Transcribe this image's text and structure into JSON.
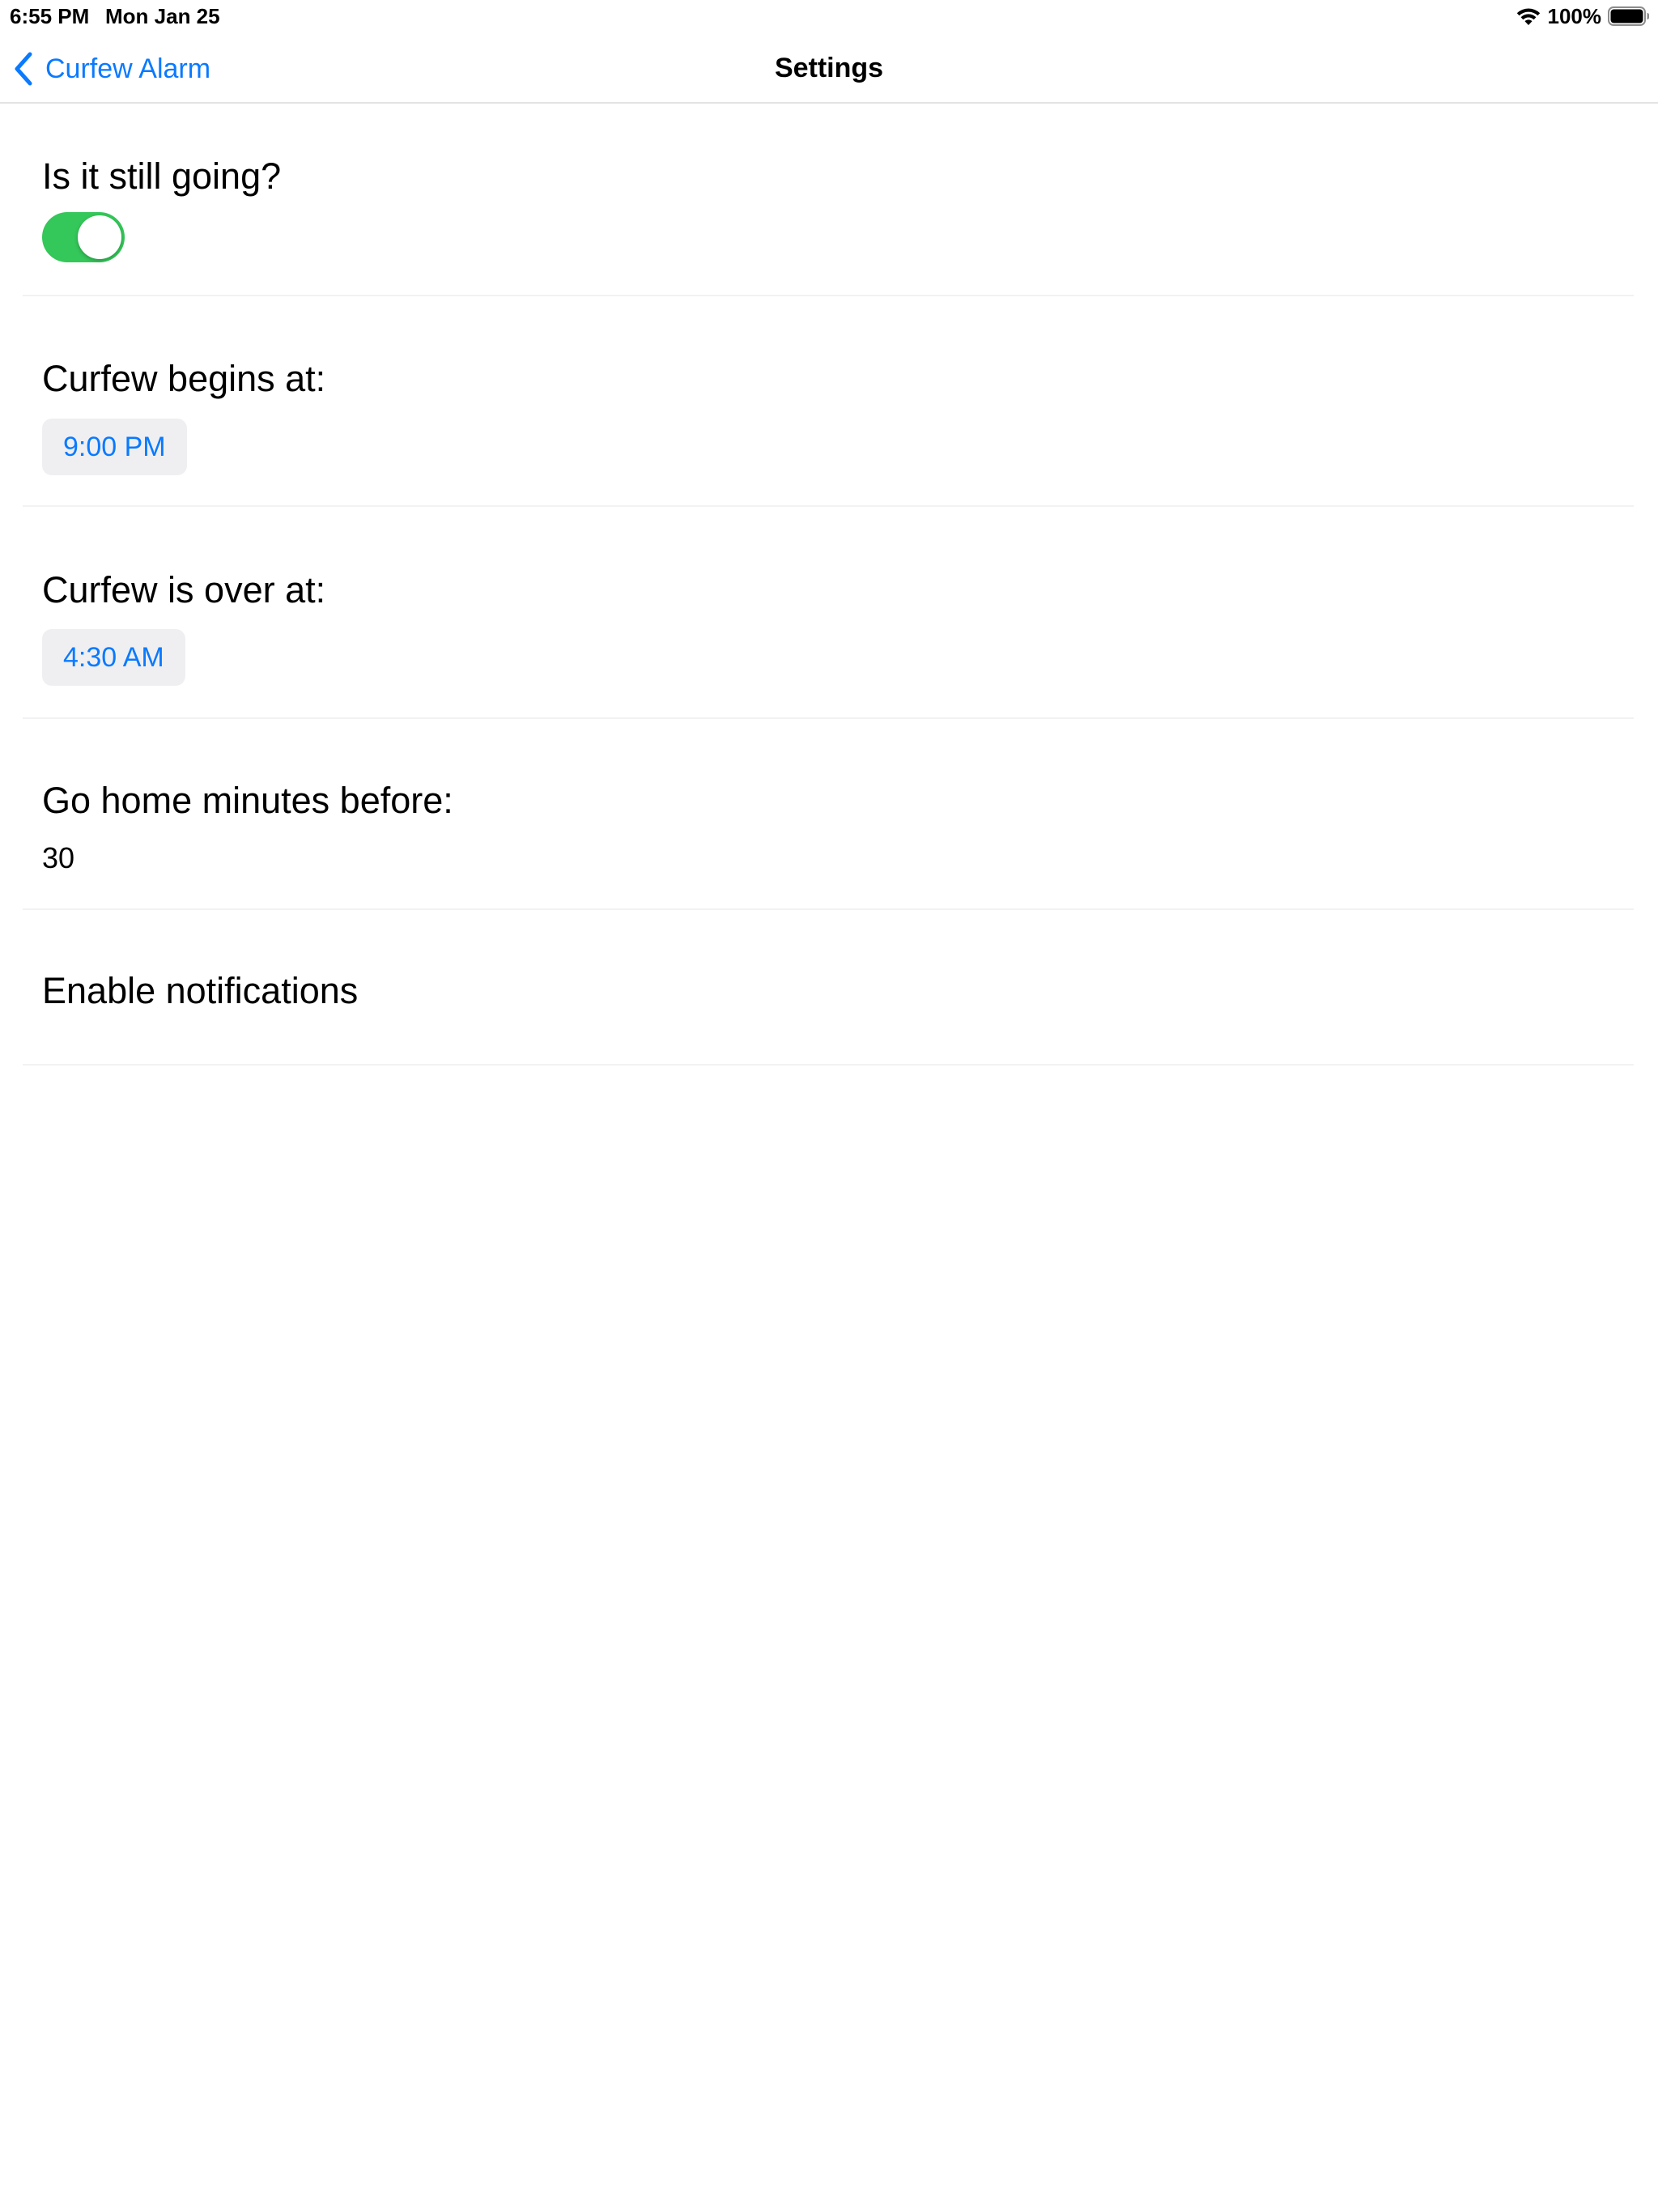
{
  "status_bar": {
    "time": "6:55 PM",
    "date": "Mon Jan 25",
    "battery_percent": "100%",
    "wifi_icon": "wifi-icon",
    "battery_icon": "battery-icon"
  },
  "nav": {
    "back_label": "Curfew Alarm",
    "back_icon": "chevron-left-icon",
    "title": "Settings"
  },
  "settings": {
    "still_going": {
      "label": "Is it still going?",
      "toggle_on": true
    },
    "begins": {
      "label": "Curfew begins at:",
      "value": "9:00 PM"
    },
    "over": {
      "label": "Curfew is over at:",
      "value": "4:30 AM"
    },
    "go_home": {
      "label": "Go home minutes before:",
      "value": "30"
    },
    "notifications": {
      "label": "Enable notifications"
    }
  },
  "colors": {
    "accent": "#0a7aff",
    "toggle_on": "#34c759",
    "pill_bg": "#efeff1",
    "separator": "#f2f2f4"
  }
}
